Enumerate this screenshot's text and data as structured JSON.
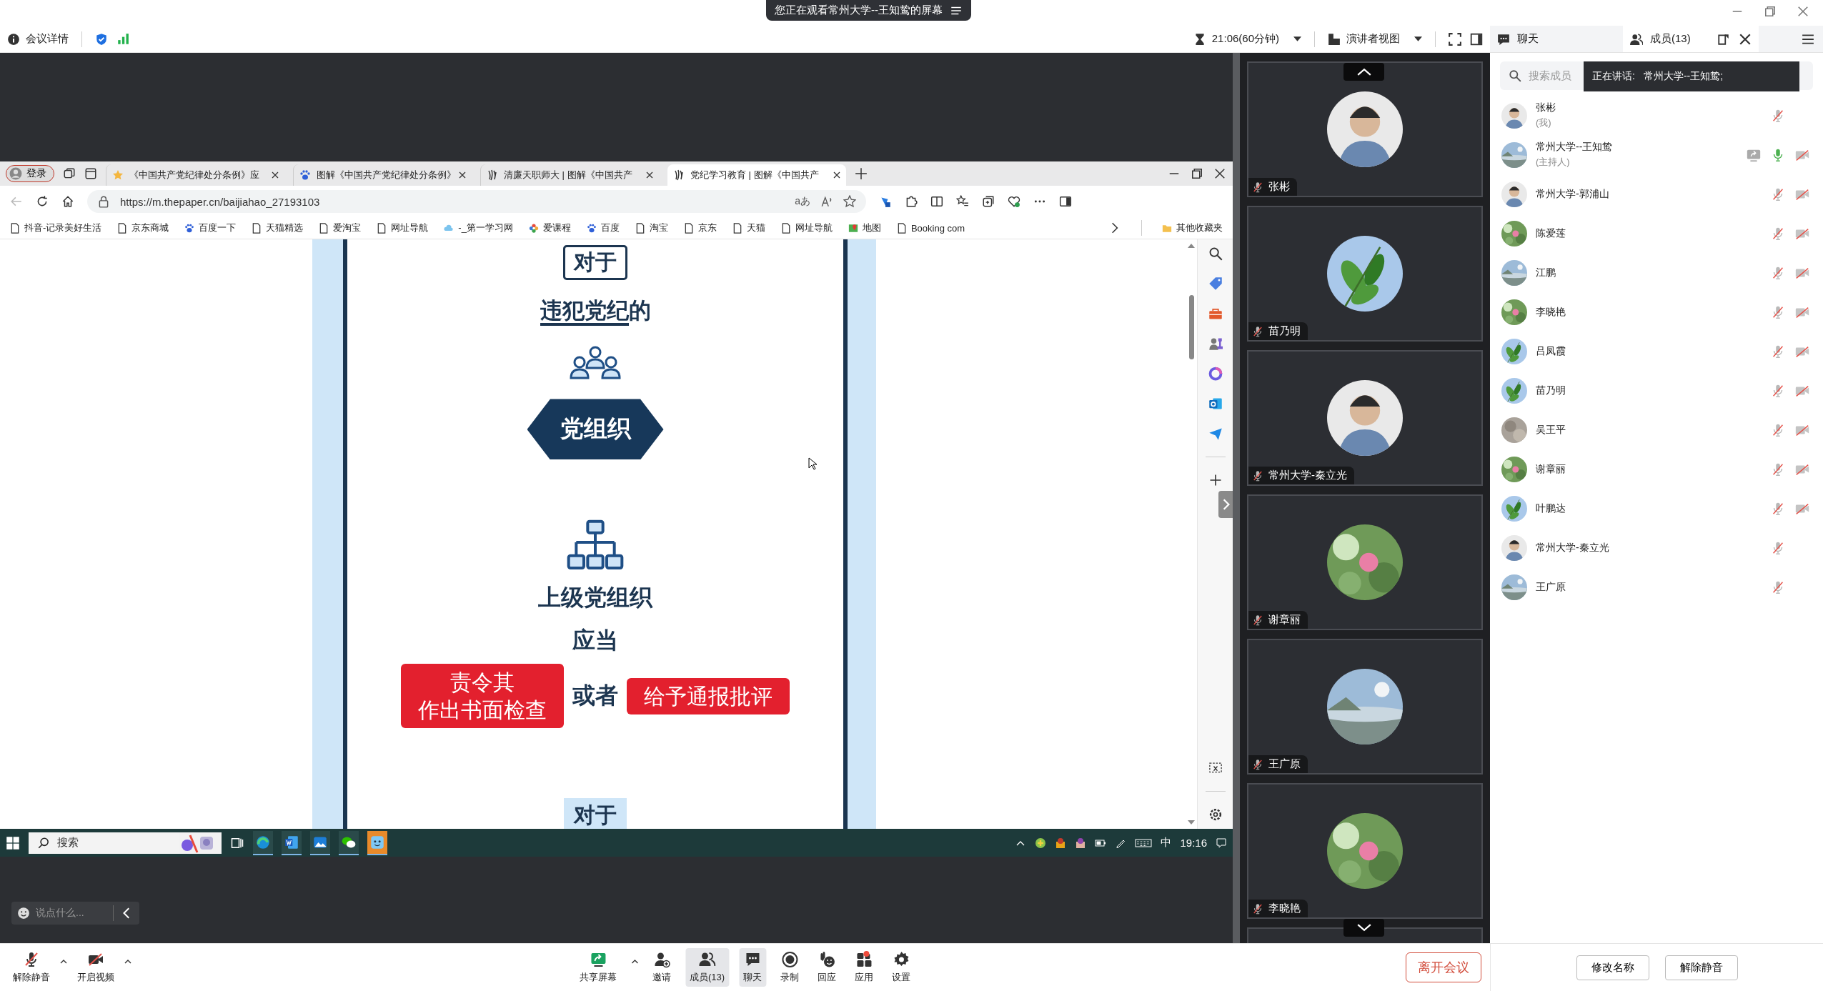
{
  "banner": {
    "text": "您正在观看常州大学--王知鸷的屏幕"
  },
  "meeting_bar": {
    "details": "会议详情",
    "timer": "21:06(60分钟)",
    "layout": "演讲者视图"
  },
  "panel_tabs": [
    {
      "label": "聊天",
      "kind": "chat",
      "selected": false
    },
    {
      "label": "成员(13)",
      "kind": "members",
      "selected": true
    }
  ],
  "browser": {
    "profile": "登录",
    "tabs": [
      {
        "title": "《中国共产党纪律处分条例》应",
        "kind": "star",
        "selected": false
      },
      {
        "title": "图解《中国共产党纪律处分条例》",
        "kind": "paw",
        "selected": false
      },
      {
        "title": "清廉天职师大 | 图解《中国共产",
        "kind": "emblem",
        "selected": false
      },
      {
        "title": "党纪学习教育 | 图解《中国共产",
        "kind": "emblem",
        "selected": true
      }
    ],
    "url": "https://m.thepaper.cn/baijiahao_27193103",
    "read_glyph": "aあ",
    "bookmarks": [
      {
        "label": "抖音-记录美好生活",
        "kind": "page"
      },
      {
        "label": "京东商城",
        "kind": "page"
      },
      {
        "label": "百度一下",
        "kind": "paw"
      },
      {
        "label": "天猫精选",
        "kind": "page"
      },
      {
        "label": "爱淘宝",
        "kind": "page"
      },
      {
        "label": "网址导航",
        "kind": "page"
      },
      {
        "label": "-_第一学习网",
        "kind": "cloud"
      },
      {
        "label": "爱课程",
        "kind": "flower"
      },
      {
        "label": "百度",
        "kind": "paw"
      },
      {
        "label": "淘宝",
        "kind": "page"
      },
      {
        "label": "京东",
        "kind": "page"
      },
      {
        "label": "天猫",
        "kind": "page"
      },
      {
        "label": "网址导航",
        "kind": "page"
      },
      {
        "label": "地图",
        "kind": "map"
      },
      {
        "label": "Booking com",
        "kind": "page"
      }
    ],
    "other_bookmarks": "其他收藏夹"
  },
  "page": {
    "heading_top": "对于",
    "line_underlined": "违犯党纪",
    "line_rest": "的",
    "org_badge": "党组织",
    "superior": "上级党组织",
    "should": "应当",
    "option_left": [
      "责令其",
      "作出书面检查"
    ],
    "connector": "或者",
    "option_right": "给予通报批评",
    "heading_bottom": "对于"
  },
  "taskbar": {
    "search": "搜索",
    "input_method": "中",
    "time": "19:16"
  },
  "chat_input": {
    "placeholder": "说点什么..."
  },
  "video_tiles": [
    {
      "name": "张彬",
      "mic_muted": true
    },
    {
      "name": "苗乃明",
      "mic_muted": true
    },
    {
      "name": "常州大学-秦立光",
      "mic_muted": true
    },
    {
      "name": "谢章丽",
      "mic_muted": true
    },
    {
      "name": "王广原",
      "mic_muted": true
    },
    {
      "name": "李晓艳",
      "mic_muted": true
    }
  ],
  "member_search": {
    "placeholder": "搜索成员"
  },
  "speaking": {
    "label": "正在讲话:",
    "name": "常州大学--王知鸷;"
  },
  "members": [
    {
      "name": "张彬",
      "role": "(我)",
      "sharing": false,
      "mic_muted": true,
      "camera_off": false
    },
    {
      "name": "常州大学--王知鸷",
      "role": "(主持人)",
      "sharing": true,
      "mic_muted": false,
      "camera_off": true
    },
    {
      "name": "常州大学-郭浦山",
      "sharing": false,
      "mic_muted": true,
      "camera_off": true
    },
    {
      "name": "陈爱莲",
      "sharing": false,
      "mic_muted": true,
      "camera_off": true
    },
    {
      "name": "江鹏",
      "sharing": false,
      "mic_muted": true,
      "camera_off": true
    },
    {
      "name": "李晓艳",
      "sharing": false,
      "mic_muted": true,
      "camera_off": true
    },
    {
      "name": "吕凤霞",
      "sharing": false,
      "mic_muted": true,
      "camera_off": true
    },
    {
      "name": "苗乃明",
      "sharing": false,
      "mic_muted": true,
      "camera_off": true
    },
    {
      "name": "吴王平",
      "sharing": false,
      "mic_muted": true,
      "camera_off": true
    },
    {
      "name": "谢章丽",
      "sharing": false,
      "mic_muted": true,
      "camera_off": true
    },
    {
      "name": "叶鹏达",
      "sharing": false,
      "mic_muted": true,
      "camera_off": true
    },
    {
      "name": "常州大学-秦立光",
      "sharing": false,
      "mic_muted": true,
      "camera_off": false
    },
    {
      "name": "王广原",
      "sharing": false,
      "mic_muted": true,
      "camera_off": false
    }
  ],
  "media_controls": [
    {
      "label": "解除静音",
      "kind": "mic-muted",
      "caret": true,
      "selected": false
    },
    {
      "label": "开启视频",
      "kind": "camera-off",
      "caret": true,
      "selected": false
    }
  ],
  "meeting_controls": [
    {
      "label": "共享屏幕",
      "kind": "share",
      "caret": true,
      "selected": false,
      "badge": false
    },
    {
      "label": "邀请",
      "kind": "invite",
      "caret": false,
      "selected": false,
      "badge": false
    },
    {
      "label": "成员(13)",
      "kind": "members",
      "caret": false,
      "selected": true,
      "badge": false
    },
    {
      "label": "聊天",
      "kind": "chat",
      "caret": false,
      "selected": true,
      "badge": false
    },
    {
      "label": "录制",
      "kind": "record",
      "caret": false,
      "selected": false,
      "badge": false
    },
    {
      "label": "回应",
      "kind": "react",
      "caret": false,
      "selected": false,
      "badge": false
    },
    {
      "label": "应用",
      "kind": "apps",
      "caret": false,
      "selected": false,
      "badge": true
    },
    {
      "label": "设置",
      "kind": "settings",
      "caret": false,
      "selected": false,
      "badge": false
    }
  ],
  "leave_button": "离开会议",
  "panel_buttons": [
    "修改名称",
    "解除静音"
  ]
}
